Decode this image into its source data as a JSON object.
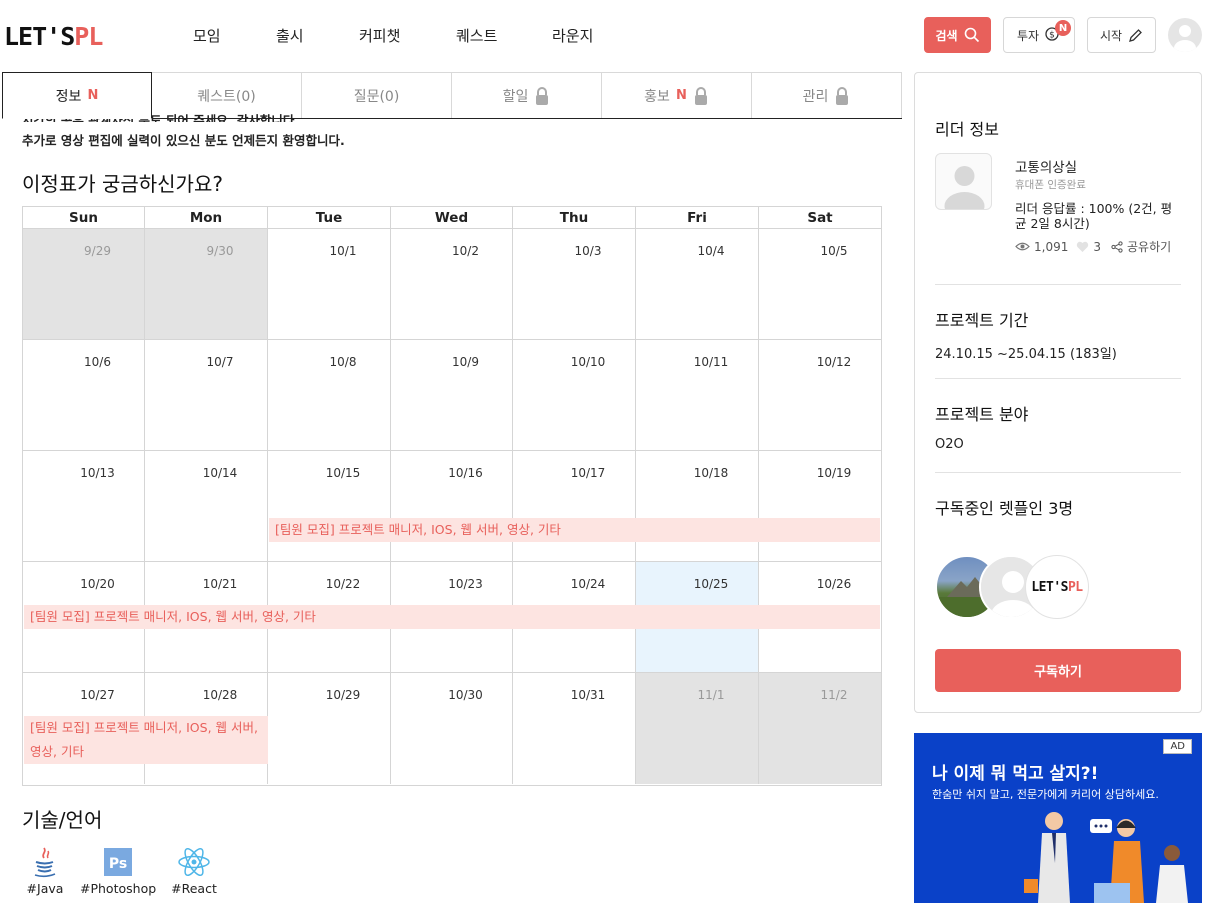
{
  "header": {
    "logo_left": "LET'S",
    "logo_right": "PL",
    "nav": [
      "모임",
      "출시",
      "커피챗",
      "퀘스트",
      "라운지"
    ],
    "search_label": "검색",
    "invest_label": "투자",
    "invest_badge": "N",
    "start_label": "시작"
  },
  "tabs": [
    {
      "label": "정보",
      "badge": "N",
      "locked": false
    },
    {
      "label": "퀘스트(0)",
      "badge": "",
      "locked": false
    },
    {
      "label": "질문(0)",
      "badge": "",
      "locked": false
    },
    {
      "label": "할일",
      "badge": "",
      "locked": true
    },
    {
      "label": "홍보",
      "badge": "N",
      "locked": true
    },
    {
      "label": "관리",
      "badge": "",
      "locked": true
    }
  ],
  "intro": {
    "cut_line": "시간의 공유 관계자신 분도 되어 주세요. 감사합니다.",
    "line": "추가로 영상 편집에 실력이 있으신 분도 언제든지 환영합니다."
  },
  "schedule": {
    "title": "이정표가 궁금하신가요?",
    "weekdays": [
      "Sun",
      "Mon",
      "Tue",
      "Wed",
      "Thu",
      "Fri",
      "Sat"
    ],
    "weeks": [
      [
        "9/29",
        "9/30",
        "10/1",
        "10/2",
        "10/3",
        "10/4",
        "10/5"
      ],
      [
        "10/6",
        "10/7",
        "10/8",
        "10/9",
        "10/10",
        "10/11",
        "10/12"
      ],
      [
        "10/13",
        "10/14",
        "10/15",
        "10/16",
        "10/17",
        "10/18",
        "10/19"
      ],
      [
        "10/20",
        "10/21",
        "10/22",
        "10/23",
        "10/24",
        "10/25",
        "10/26"
      ],
      [
        "10/27",
        "10/28",
        "10/29",
        "10/30",
        "10/31",
        "11/1",
        "11/2"
      ]
    ],
    "event_label": "[팀원 모집] 프로젝트 매니저, IOS, 웹 서버, 영상, 기타"
  },
  "tech": {
    "title": "기술/언어",
    "items": [
      {
        "label": "#Java",
        "icon": "java-icon"
      },
      {
        "label": "#Photoshop",
        "icon": "photoshop-icon"
      },
      {
        "label": "#React",
        "icon": "react-icon"
      }
    ]
  },
  "leader": {
    "title": "리더 정보",
    "name": "고통의상실",
    "verified": "휴대폰 인증완료",
    "response_line1": "리더 응답률 : 100% (2건, 평",
    "response_line2": "균 2일 8시간)",
    "views": "1,091",
    "likes": "3",
    "share": "공유하기"
  },
  "period": {
    "title": "프로젝트 기간",
    "value": "24.10.15 ~25.04.15  (183일)"
  },
  "field": {
    "title": "프로젝트 분야",
    "value": "O2O"
  },
  "subscribers": {
    "title": "구독중인 렛플인 3명",
    "button": "구독하기",
    "logo_text": "LET'S",
    "logo_accent": "PL"
  },
  "ad": {
    "tag": "AD",
    "headline": "나 이제 뭐 먹고 살지?!",
    "sub": "한숨만 쉬지 말고, 전문가에게 커리어 상담하세요."
  },
  "colors": {
    "accent": "#e8605b",
    "event_bg": "#fde4e1",
    "today_bg": "#e8f4fd",
    "other_month_bg": "#e3e3e3",
    "ad_bg": "#0a41c8"
  }
}
